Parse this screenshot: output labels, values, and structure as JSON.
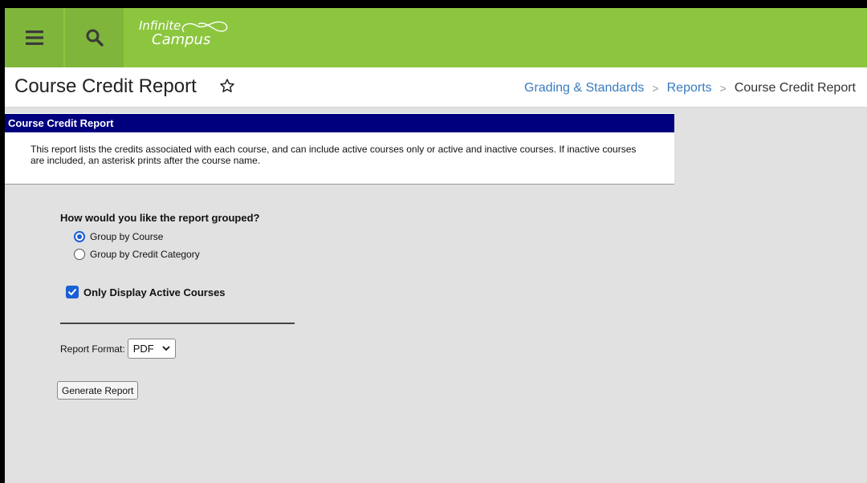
{
  "header": {
    "logo_line1": "Infinite",
    "logo_line2": "Campus",
    "menu_icon": "hamburger-menu-icon",
    "search_icon": "search-icon",
    "colors": {
      "brand_green": "#8cc63f",
      "panel_navy": "#00007f",
      "link_blue": "#3a7bbf",
      "accent_blue": "#1a5fd6"
    }
  },
  "title": {
    "text": "Course Credit Report",
    "favorite_icon": "star-outline-icon"
  },
  "breadcrumb": {
    "items": [
      "Grading & Standards",
      "Reports",
      "Course Credit Report"
    ],
    "separator": ">"
  },
  "panel": {
    "heading": "Course Credit Report",
    "description": "This report lists the credits associated with each course, and can include active courses only or active and inactive courses. If inactive courses are included, an asterisk prints after the course name."
  },
  "form": {
    "group_question": "How would you like the report grouped?",
    "group_options": [
      {
        "label": "Group by Course",
        "selected": true
      },
      {
        "label": "Group by Credit Category",
        "selected": false
      }
    ],
    "active_only": {
      "label": "Only Display Active Courses",
      "checked": true
    },
    "format_label": "Report Format:",
    "format_value": "PDF",
    "generate_label": "Generate Report"
  }
}
